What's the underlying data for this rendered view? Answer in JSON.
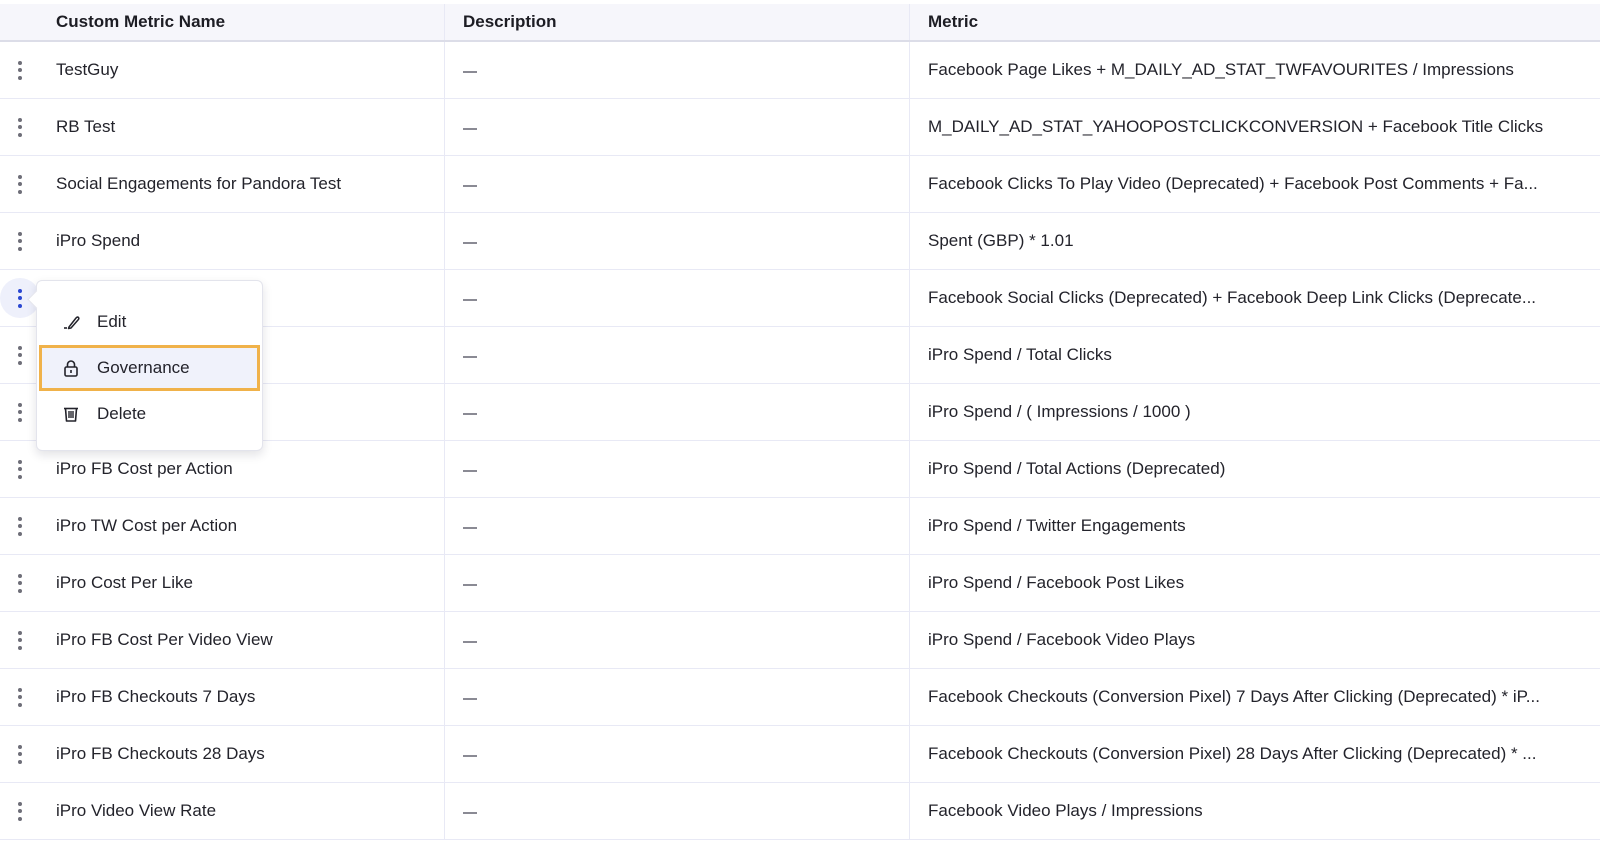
{
  "table": {
    "columns": {
      "name": "Custom Metric Name",
      "description": "Description",
      "metric": "Metric"
    },
    "rows": [
      {
        "name": "TestGuy",
        "description": "—",
        "metric": "Facebook Page Likes + M_DAILY_AD_STAT_TWFAVOURITES / Impressions"
      },
      {
        "name": "RB Test",
        "description": "—",
        "metric": "M_DAILY_AD_STAT_YAHOOPOSTCLICKCONVERSION + Facebook Title Clicks"
      },
      {
        "name": "Social Engagements for Pandora Test",
        "description": "—",
        "metric": "Facebook Clicks To Play Video (Deprecated) + Facebook Post Comments + Fa..."
      },
      {
        "name": "iPro Spend",
        "description": "—",
        "metric": "Spent (GBP) * 1.01"
      },
      {
        "name": "",
        "description": "—",
        "metric": "Facebook Social Clicks (Deprecated) + Facebook Deep Link Clicks (Deprecate..."
      },
      {
        "name": "",
        "description": "—",
        "metric": "iPro Spend / Total Clicks"
      },
      {
        "name": "",
        "description": "—",
        "metric": "iPro Spend / ( Impressions / 1000 )"
      },
      {
        "name": "iPro FB Cost per Action",
        "description": "—",
        "metric": "iPro Spend / Total Actions (Deprecated)"
      },
      {
        "name": "iPro TW Cost per Action",
        "description": "—",
        "metric": "iPro Spend / Twitter Engagements"
      },
      {
        "name": "iPro Cost Per Like",
        "description": "—",
        "metric": "iPro Spend / Facebook Post Likes"
      },
      {
        "name": "iPro FB Cost Per Video View",
        "description": "—",
        "metric": "iPro Spend / Facebook Video Plays"
      },
      {
        "name": "iPro FB Checkouts 7 Days",
        "description": "—",
        "metric": "Facebook Checkouts (Conversion Pixel) 7 Days After Clicking (Deprecated) * iP..."
      },
      {
        "name": "iPro FB Checkouts 28 Days",
        "description": "—",
        "metric": "Facebook Checkouts (Conversion Pixel) 28 Days After Clicking (Deprecated) * ..."
      },
      {
        "name": "iPro Video View Rate",
        "description": "—",
        "metric": "Facebook Video Plays / Impressions"
      }
    ]
  },
  "context_menu": {
    "open_for_row": 5,
    "items": [
      {
        "label": "Edit",
        "icon": "pencil-icon"
      },
      {
        "label": "Governance",
        "icon": "lock-icon",
        "highlighted": true
      },
      {
        "label": "Delete",
        "icon": "trash-icon"
      }
    ]
  },
  "colors": {
    "highlight_outline": "#f0b24a",
    "active_kebab": "#2a47d1",
    "header_bg": "#f6f6fb"
  }
}
